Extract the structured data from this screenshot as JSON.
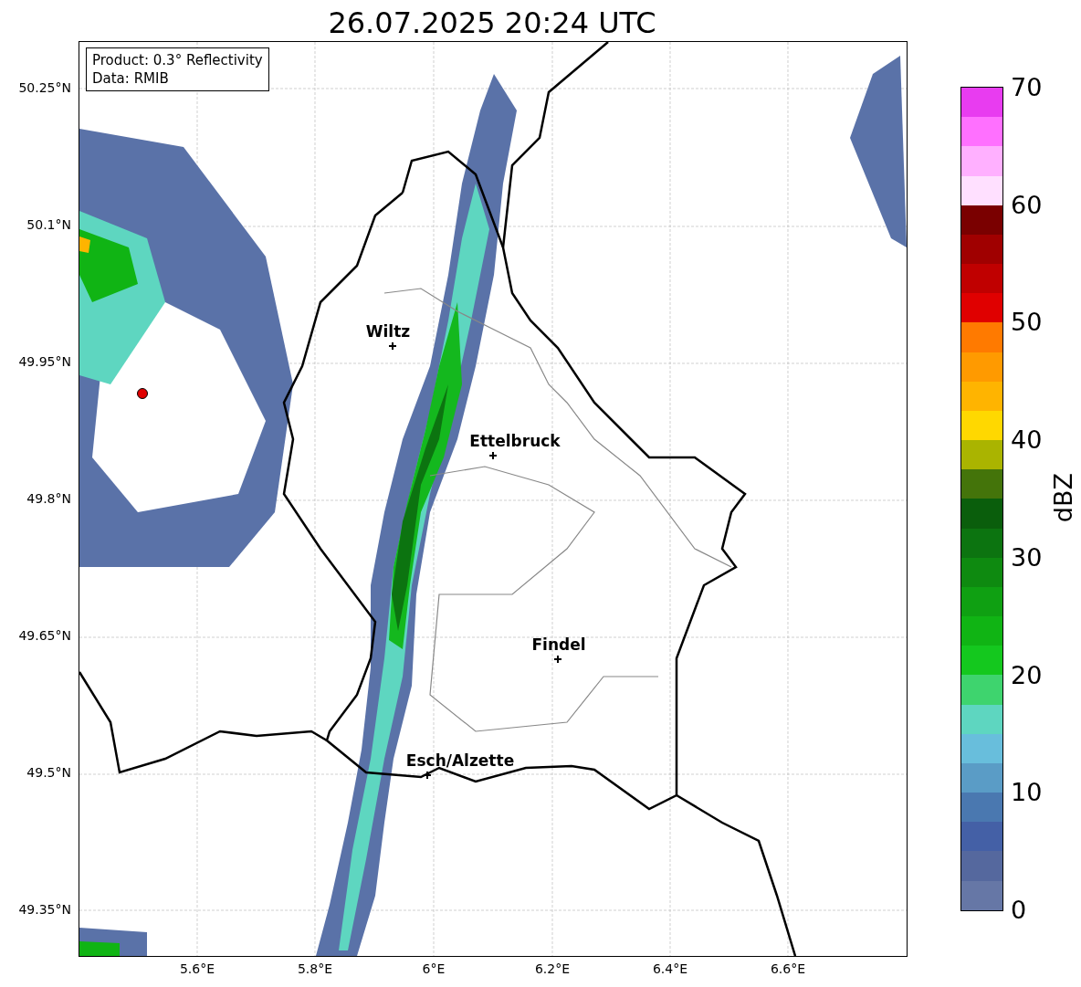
{
  "title": "26.07.2025 20:24 UTC",
  "info_box": {
    "lines": [
      "Product: 0.3° Reflectivity",
      "Data: RMIB"
    ]
  },
  "map": {
    "x_ticks": [
      "5.6°E",
      "5.8°E",
      "6°E",
      "6.2°E",
      "6.4°E",
      "6.6°E"
    ],
    "y_ticks": [
      "50.25°N",
      "50.1°N",
      "49.95°N",
      "49.8°N",
      "49.65°N",
      "49.5°N",
      "49.35°N"
    ],
    "places": [
      {
        "name": "Wiltz"
      },
      {
        "name": "Ettelbruck"
      },
      {
        "name": "Findel"
      },
      {
        "name": "Esch/Alzette"
      }
    ]
  },
  "colorbar": {
    "label": "dBZ",
    "ticks": [
      "70",
      "60",
      "50",
      "40",
      "30",
      "20",
      "10",
      "0"
    ],
    "bins": [
      {
        "color": "#e83cf0"
      },
      {
        "color": "#ff70ff"
      },
      {
        "color": "#ffb0ff"
      },
      {
        "color": "#ffe0ff"
      },
      {
        "color": "#7a0000"
      },
      {
        "color": "#a00000"
      },
      {
        "color": "#c00000"
      },
      {
        "color": "#e00000"
      },
      {
        "color": "#ff7a00"
      },
      {
        "color": "#ff9a00"
      },
      {
        "color": "#ffb400"
      },
      {
        "color": "#ffd800"
      },
      {
        "color": "#aab400"
      },
      {
        "color": "#44740a"
      },
      {
        "color": "#0a5e0c"
      },
      {
        "color": "#0c7410"
      },
      {
        "color": "#0e8a10"
      },
      {
        "color": "#0fa012"
      },
      {
        "color": "#10b414"
      },
      {
        "color": "#14c81e"
      },
      {
        "color": "#3ed46e"
      },
      {
        "color": "#5ed6c0"
      },
      {
        "color": "#68bedc"
      },
      {
        "color": "#5a9cc6"
      },
      {
        "color": "#4a78b0"
      },
      {
        "color": "#4460a6"
      },
      {
        "color": "#55689e"
      },
      {
        "color": "#6677a6"
      }
    ]
  }
}
